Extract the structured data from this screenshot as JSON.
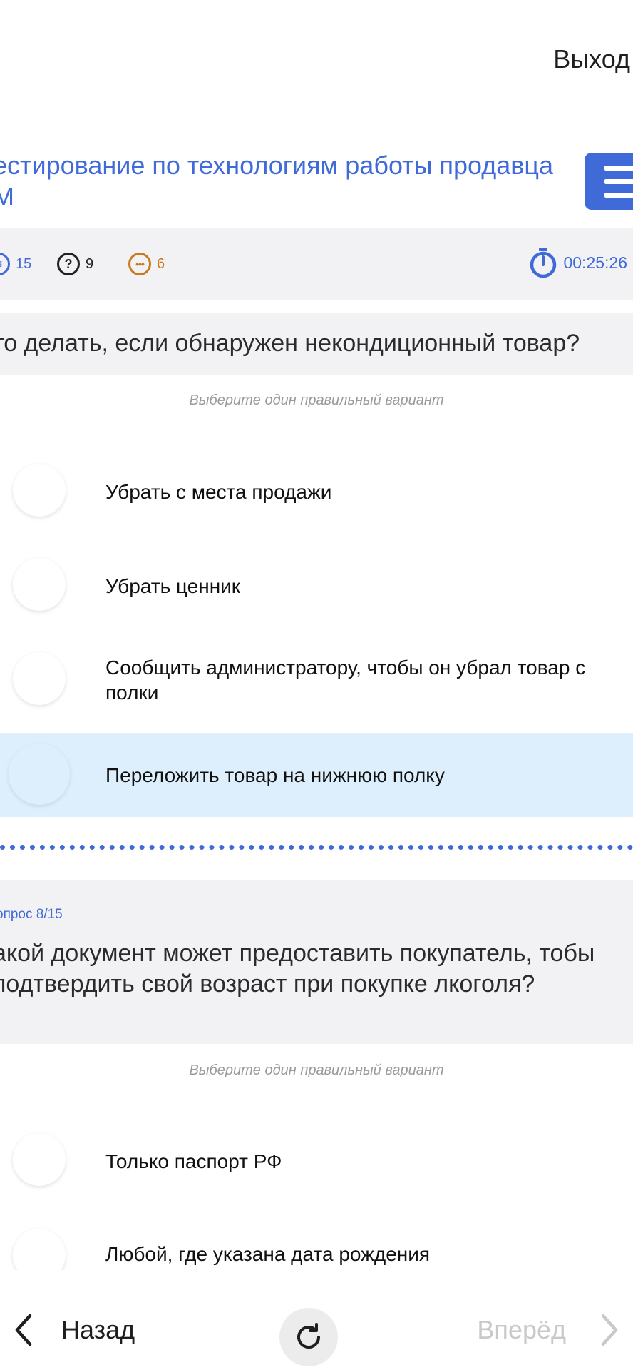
{
  "header": {
    "logout_label": "Выход",
    "test_title": "естирование по технологиям работы продавца М"
  },
  "stats": {
    "total": "15",
    "unanswered": "9",
    "skipped": "6",
    "timer": "00:25:26",
    "unanswered_icon_glyph": "?",
    "skipped_icon_glyph": "•••"
  },
  "questions": [
    {
      "text": "то делать, если обнаружен некондиционный товар?",
      "hint": "Выберите один правильный вариант",
      "options": [
        {
          "label": "Убрать с места продажи",
          "selected": false
        },
        {
          "label": "Убрать ценник",
          "selected": false
        },
        {
          "label": "Сообщить администратору, чтобы он убрал товар с полки",
          "selected": false
        },
        {
          "label": "Переложить товар на нижнюю полку",
          "selected": true
        }
      ]
    },
    {
      "number_label": "опрос 8/15",
      "text": "акой документ может предоставить покупатель, тобы подтвердить свой возраст при покупке лкоголя?",
      "hint": "Выберите один правильный вариант",
      "options": [
        {
          "label": "Только паспорт РФ",
          "selected": false
        },
        {
          "label": "Любой, где указана дата рождения",
          "selected": false
        }
      ]
    }
  ],
  "nav": {
    "back_label": "Назад",
    "forward_label": "Вперёд"
  },
  "colors": {
    "accent": "#3f6ad8",
    "selected_bg": "#ddeefc",
    "panel_bg": "#f2f2f4",
    "skipped": "#c77a1e"
  },
  "icons": {
    "menu": "hamburger-icon",
    "timer": "stopwatch-icon",
    "refresh": "refresh-icon",
    "back": "chevron-left-icon",
    "forward": "chevron-right-icon"
  }
}
